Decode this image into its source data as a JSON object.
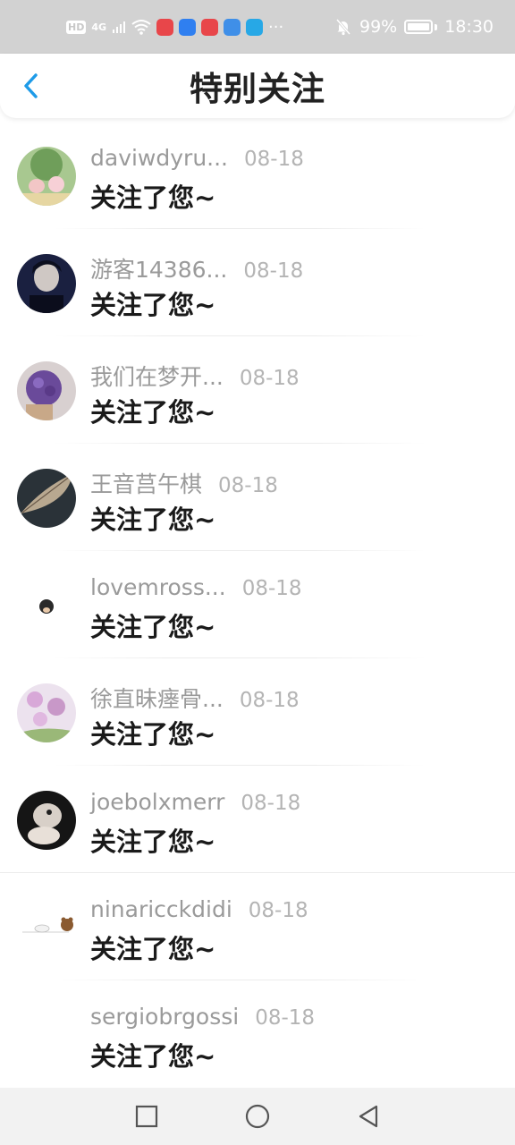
{
  "status_bar": {
    "hd": "HD",
    "network": "4G",
    "dots": "···",
    "battery": "99%",
    "time": "18:30",
    "app_icon_colors": [
      "#e8464a",
      "#2f7ff0",
      "#e8464a",
      "#3f8fe8",
      "#27a8e6"
    ]
  },
  "header": {
    "title": "特别关注",
    "back_icon": "chevron-left-icon",
    "accent_color": "#1e9be8"
  },
  "list": [
    {
      "name": "daviwdyru...",
      "date": "08-18",
      "message": "关注了您~"
    },
    {
      "name": "游客14386...",
      "date": "08-18",
      "message": "关注了您~"
    },
    {
      "name": "我们在梦开...",
      "date": "08-18",
      "message": "关注了您~"
    },
    {
      "name": "王音莒午棋",
      "date": "08-18",
      "message": "关注了您~"
    },
    {
      "name": "lovemross...",
      "date": "08-18",
      "message": "关注了您~"
    },
    {
      "name": "徐直昧瘗骨...",
      "date": "08-18",
      "message": "关注了您~"
    },
    {
      "name": "joebolxmerr",
      "date": "08-18",
      "message": "关注了您~"
    },
    {
      "name": "ninaricckdidi",
      "date": "08-18",
      "message": "关注了您~"
    },
    {
      "name": "sergiobrgossi",
      "date": "08-18",
      "message": "关注了您~"
    }
  ],
  "nav_bar": {
    "icons": [
      "recents-square-icon",
      "home-circle-icon",
      "back-triangle-icon"
    ]
  }
}
